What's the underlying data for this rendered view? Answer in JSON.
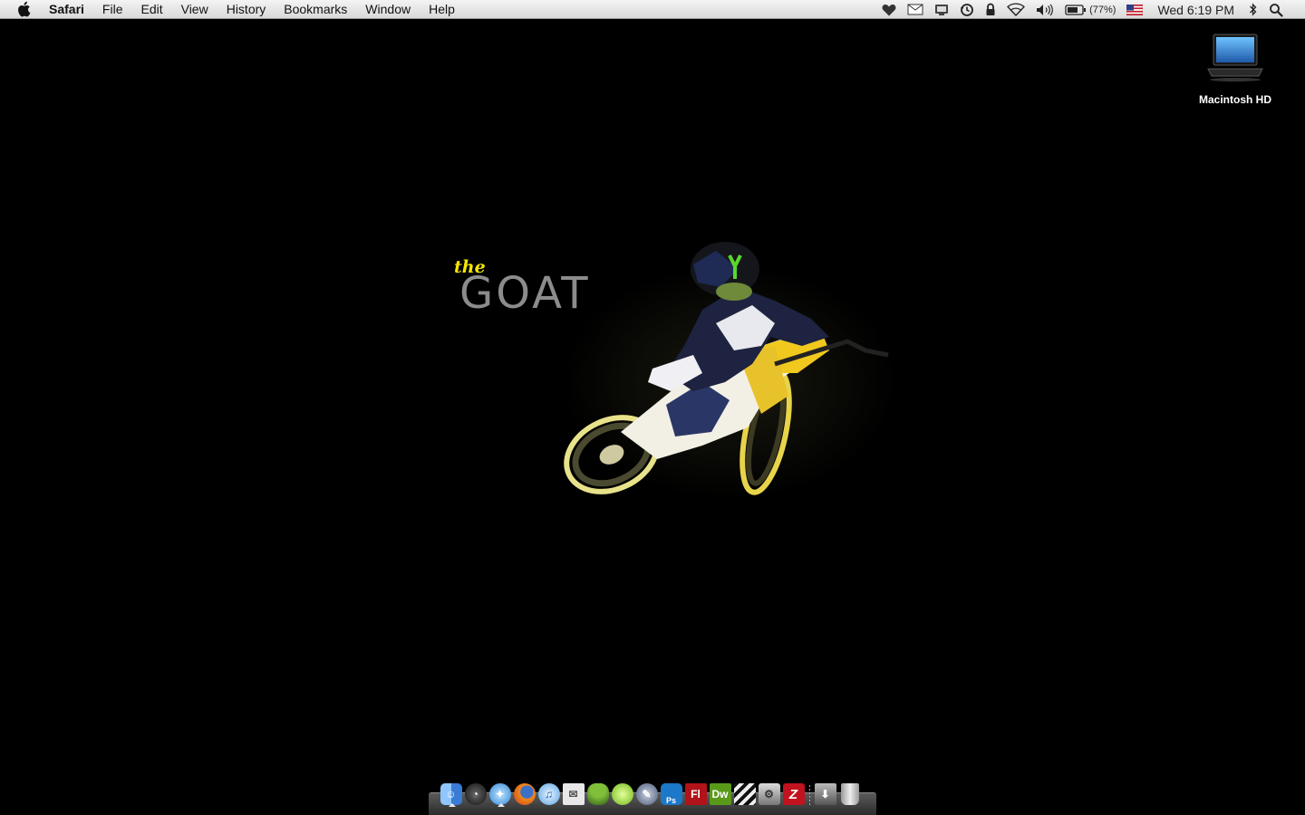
{
  "menubar": {
    "app_name": "Safari",
    "menus": [
      "File",
      "Edit",
      "View",
      "History",
      "Bookmarks",
      "Window",
      "Help"
    ],
    "status": {
      "battery_percent": "(77%)",
      "clock": "Wed 6:19 PM"
    }
  },
  "desktop": {
    "icons": [
      {
        "label": "Macintosh HD"
      }
    ]
  },
  "wallpaper": {
    "small_text": "the",
    "large_text": "GOAT"
  },
  "dock": {
    "apps": [
      {
        "name": "finder",
        "color": "#3a7bd5",
        "running": true
      },
      {
        "name": "dashboard",
        "color": "#333333",
        "running": false
      },
      {
        "name": "safari",
        "color": "#4aa3e0",
        "running": true
      },
      {
        "name": "firefox",
        "color": "#e5671c",
        "running": false
      },
      {
        "name": "itunes",
        "color": "#6fb2e8",
        "running": false
      },
      {
        "name": "mail",
        "color": "#d8d8d8",
        "running": false
      },
      {
        "name": "adium",
        "color": "#4f8a2a",
        "running": false
      },
      {
        "name": "limewire",
        "color": "#8fd12a",
        "running": false
      },
      {
        "name": "script-editor",
        "color": "#5a6a88",
        "running": false
      },
      {
        "name": "photoshop",
        "color": "#1c78c8",
        "glyph": "Ps",
        "running": false
      },
      {
        "name": "flash",
        "color": "#b0141a",
        "glyph": "Fl",
        "running": false
      },
      {
        "name": "dreamweaver",
        "color": "#5a9a1a",
        "glyph": "Dw",
        "running": false
      },
      {
        "name": "final-cut",
        "color": "#222222",
        "running": false
      },
      {
        "name": "ical-utility",
        "color": "#777777",
        "running": false
      },
      {
        "name": "filezilla",
        "color": "#c1121f",
        "glyph": "Z",
        "running": false
      }
    ],
    "stacks": [
      {
        "name": "downloads-stack",
        "color": "#6a6a6a"
      },
      {
        "name": "trash",
        "color": "#bdbdbd"
      }
    ]
  }
}
